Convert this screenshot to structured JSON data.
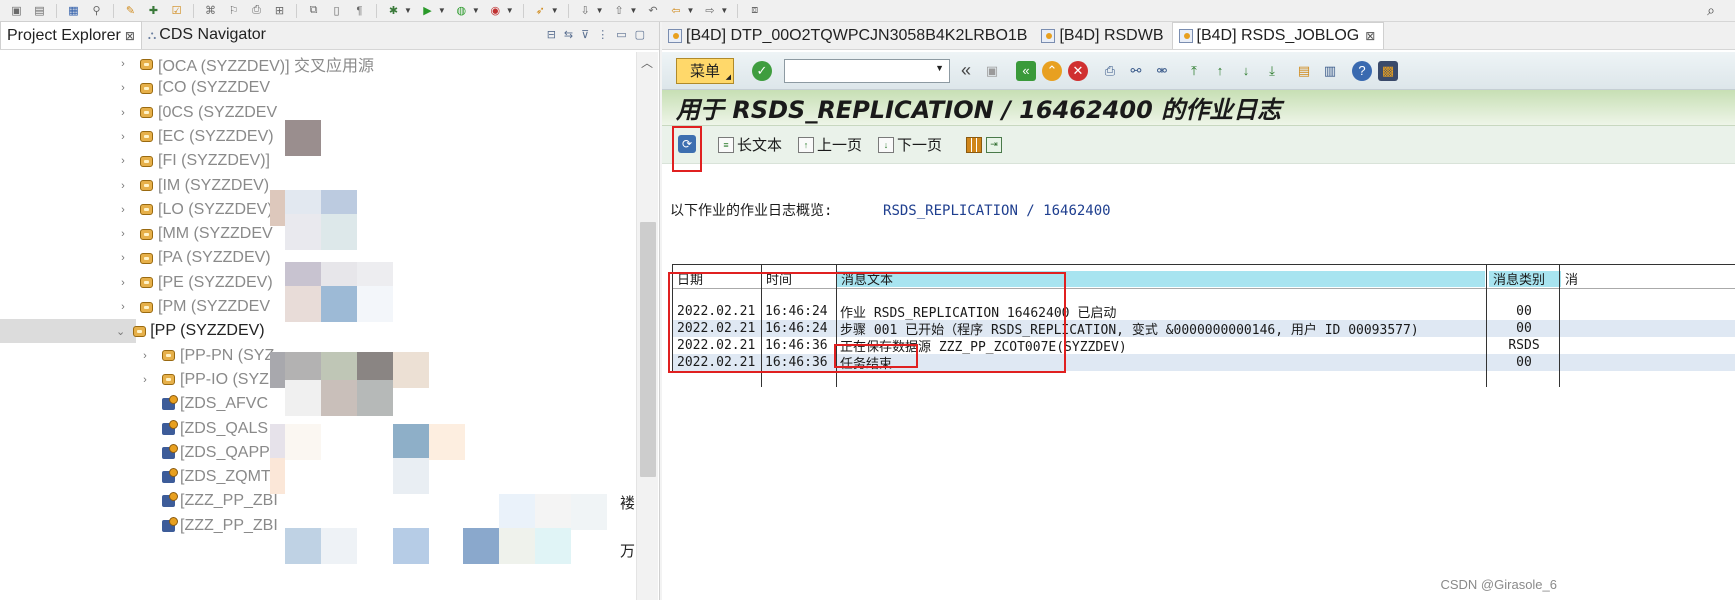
{
  "left_tabs": [
    {
      "label": "Project Explorer",
      "active": true
    },
    {
      "label": "CDS Navigator",
      "active": false
    }
  ],
  "tree": [
    {
      "label": "[OCA (SYZZDEV)] 交叉应用源",
      "indent": 0,
      "type": "package",
      "twisty": "›"
    },
    {
      "label": "[CO (SYZZDEV",
      "indent": 0,
      "type": "package",
      "twisty": "›"
    },
    {
      "label": "[0CS (SYZZDEV",
      "indent": 0,
      "type": "package",
      "twisty": "›"
    },
    {
      "label": "[EC (SYZZDEV)",
      "indent": 0,
      "type": "package",
      "twisty": "›"
    },
    {
      "label": "[FI (SYZZDEV)]",
      "indent": 0,
      "type": "package",
      "twisty": "›"
    },
    {
      "label": "[IM (SYZZDEV)",
      "indent": 0,
      "type": "package",
      "twisty": "›"
    },
    {
      "label": "[LO (SYZZDEV)",
      "indent": 0,
      "type": "package",
      "twisty": "›"
    },
    {
      "label": "[MM (SYZZDEV",
      "indent": 0,
      "type": "package",
      "twisty": "›"
    },
    {
      "label": "[PA (SYZZDEV)",
      "indent": 0,
      "type": "package",
      "twisty": "›"
    },
    {
      "label": "[PE (SYZZDEV)",
      "indent": 0,
      "type": "package",
      "twisty": "›"
    },
    {
      "label": "[PM (SYZZDEV",
      "indent": 0,
      "type": "package",
      "twisty": "›"
    },
    {
      "label": "[PP (SYZZDEV)",
      "indent": 0,
      "type": "package",
      "twisty": "⌄",
      "selected": true
    },
    {
      "label": "[PP-PN (SYZ",
      "indent": 1,
      "type": "package",
      "twisty": "›"
    },
    {
      "label": "[PP-IO (SYZ",
      "indent": 1,
      "type": "package",
      "twisty": "›"
    },
    {
      "label": "[ZDS_AFVC",
      "indent": 1,
      "type": "cds",
      "twisty": ""
    },
    {
      "label": "[ZDS_QALS",
      "indent": 1,
      "type": "cds",
      "twisty": ""
    },
    {
      "label": "[ZDS_QAPP",
      "indent": 1,
      "type": "cds",
      "twisty": ""
    },
    {
      "label": "[ZDS_ZQMT",
      "indent": 1,
      "type": "cds",
      "twisty": ""
    },
    {
      "label": "[ZZZ_PP_ZBI",
      "indent": 1,
      "type": "cds",
      "twisty": ""
    },
    {
      "label": "[ZZZ_PP_ZBI",
      "indent": 1,
      "type": "cds",
      "twisty": ""
    }
  ],
  "tree_stray_text": [
    "褛",
    "万"
  ],
  "editor_tabs": [
    {
      "label": "[B4D] DTP_00O2TQWPCJN3058B4K2LRBO1B",
      "active": false
    },
    {
      "label": "[B4D] RSDWB",
      "active": false
    },
    {
      "label": "[B4D] RSDS_JOBLOG",
      "active": true
    }
  ],
  "sap": {
    "menu_label": "菜单",
    "title": "用于 RSDS_REPLICATION / 16462400 的作业日志",
    "app_buttons": [
      "长文本",
      "上一页",
      "下一页"
    ],
    "overview_label": "以下作业的作业日志概览:",
    "overview_value": "RSDS_REPLICATION / 16462400",
    "columns": {
      "date": "日期",
      "time": "时间",
      "text": "消息文本",
      "class": "消息类别",
      "extra": "消"
    },
    "rows": [
      {
        "date": "2022.02.21",
        "time": "16:46:24",
        "text": "作业 RSDS_REPLICATION 16462400 已启动",
        "class": "00"
      },
      {
        "date": "2022.02.21",
        "time": "16:46:24",
        "text": "步骤 001 已开始（程序 RSDS_REPLICATION, 变式 &0000000000146, 用户 ID 00093577)",
        "class": "00"
      },
      {
        "date": "2022.02.21",
        "time": "16:46:36",
        "text": "正在保存数据源 ZZZ_PP_ZCOT007E(SYZZDEV)",
        "class": "RSDS"
      },
      {
        "date": "2022.02.21",
        "time": "16:46:36",
        "text": "任务结束",
        "class": "00"
      }
    ]
  },
  "watermark": "CSDN @Girasole_6",
  "colors": {
    "title_bg": "#c7dfb4",
    "menu_btn": "#ffd86a",
    "highlight_red": "#e02020",
    "column_header": "#a8e4f0",
    "row_alt": "#dfe8f3"
  }
}
